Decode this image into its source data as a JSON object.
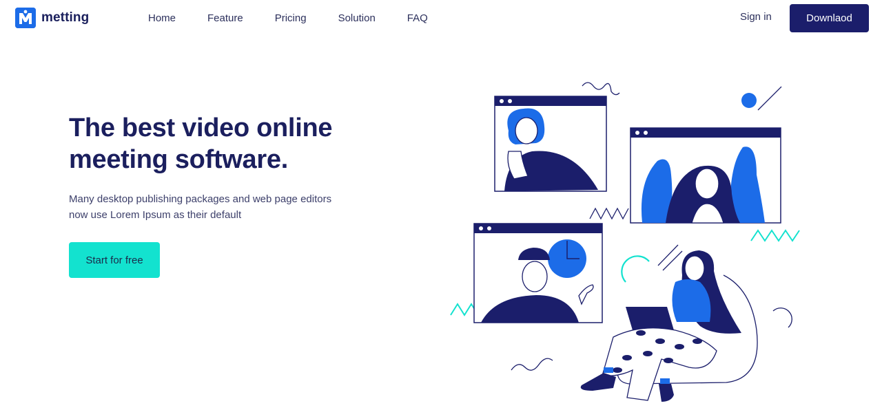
{
  "brand": {
    "name": "metting",
    "logo_letter": "M"
  },
  "nav": {
    "items": [
      "Home",
      "Feature",
      "Pricing",
      "Solution",
      "FAQ"
    ],
    "signin_label": "Sign in",
    "download_label": "Downlaod"
  },
  "hero": {
    "title_line1": "The best video online",
    "title_line2": "meeting software.",
    "subtitle_line1": "Many desktop publishing packages and web page editors",
    "subtitle_line2": "now use Lorem Ipsum as their default",
    "cta_label": "Start for free"
  },
  "colors": {
    "navy": "#1b1e6b",
    "blue": "#1c6ce8",
    "teal": "#13e2cf",
    "text": "#1b1f5e"
  },
  "icons": [
    "logo-mark-icon",
    "video-call-illustration"
  ]
}
